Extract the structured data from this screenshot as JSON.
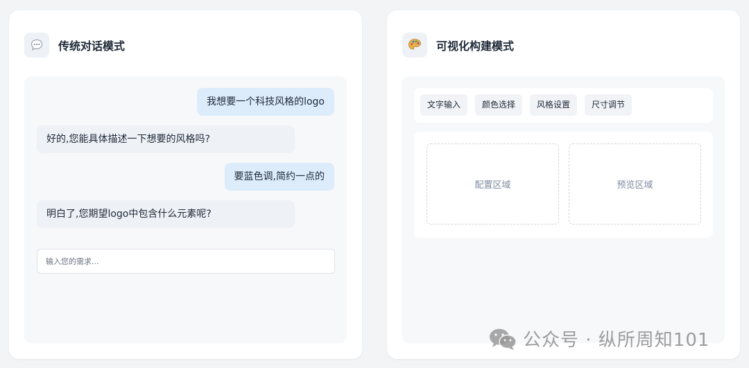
{
  "left_card": {
    "icon": "speech-bubble-icon",
    "title": "传统对话模式",
    "messages": [
      {
        "role": "user",
        "text": "我想要一个科技风格的logo"
      },
      {
        "role": "bot",
        "text": "好的,您能具体描述一下想要的风格吗?"
      },
      {
        "role": "user",
        "text": "要蓝色调,简约一点的"
      },
      {
        "role": "bot",
        "text": "明白了,您期望logo中包含什么元素呢?"
      }
    ],
    "input": {
      "placeholder": "输入您的需求...",
      "value": ""
    }
  },
  "right_card": {
    "icon": "palette-icon",
    "title": "可视化构建模式",
    "toolbar": [
      "文字输入",
      "颜色选择",
      "风格设置",
      "尺寸调节"
    ],
    "zones": {
      "config": "配置区域",
      "preview": "预览区域"
    }
  },
  "watermark": {
    "icon": "wechat-icon",
    "text": "公众号 · 纵所周知101"
  },
  "colors": {
    "page_bg": "#f3f4f6",
    "user_bubble": "#dcecfb",
    "bot_bubble": "#eef1f6",
    "zone_text": "#7d8ca3"
  }
}
